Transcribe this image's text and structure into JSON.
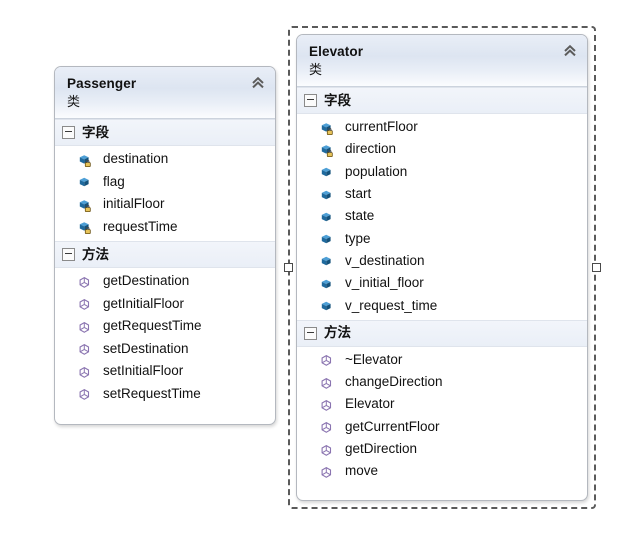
{
  "diagram": {
    "background_color": "#ffffff",
    "accent_color": "#dde5f1",
    "field_icon_color": "#1f6a9e",
    "method_icon_color": "#8a74b0"
  },
  "classes": [
    {
      "name": "Passenger",
      "kind_label": "类",
      "selected": false,
      "collapse_icon": "chevron-double-up-icon",
      "compartments": [
        {
          "title": "字段",
          "expander_state": "expanded",
          "members": [
            {
              "name": "destination",
              "icon": "field-icon",
              "visibility": "private"
            },
            {
              "name": "flag",
              "icon": "field-icon",
              "visibility": "public"
            },
            {
              "name": "initialFloor",
              "icon": "field-icon",
              "visibility": "private"
            },
            {
              "name": "requestTime",
              "icon": "field-icon",
              "visibility": "private"
            }
          ]
        },
        {
          "title": "方法",
          "expander_state": "expanded",
          "members": [
            {
              "name": "getDestination",
              "icon": "method-icon",
              "visibility": "public"
            },
            {
              "name": "getInitialFloor",
              "icon": "method-icon",
              "visibility": "public"
            },
            {
              "name": "getRequestTime",
              "icon": "method-icon",
              "visibility": "public"
            },
            {
              "name": "setDestination",
              "icon": "method-icon",
              "visibility": "public"
            },
            {
              "name": "setInitialFloor",
              "icon": "method-icon",
              "visibility": "public"
            },
            {
              "name": "setRequestTime",
              "icon": "method-icon",
              "visibility": "public"
            }
          ]
        }
      ]
    },
    {
      "name": "Elevator",
      "kind_label": "类",
      "selected": true,
      "collapse_icon": "chevron-double-up-icon",
      "compartments": [
        {
          "title": "字段",
          "expander_state": "expanded",
          "members": [
            {
              "name": "currentFloor",
              "icon": "field-icon",
              "visibility": "private"
            },
            {
              "name": "direction",
              "icon": "field-icon",
              "visibility": "private"
            },
            {
              "name": "population",
              "icon": "field-icon",
              "visibility": "public"
            },
            {
              "name": "start",
              "icon": "field-icon",
              "visibility": "public"
            },
            {
              "name": "state",
              "icon": "field-icon",
              "visibility": "public"
            },
            {
              "name": "type",
              "icon": "field-icon",
              "visibility": "public"
            },
            {
              "name": "v_destination",
              "icon": "field-icon",
              "visibility": "public"
            },
            {
              "name": "v_initial_floor",
              "icon": "field-icon",
              "visibility": "public"
            },
            {
              "name": "v_request_time",
              "icon": "field-icon",
              "visibility": "public"
            }
          ]
        },
        {
          "title": "方法",
          "expander_state": "expanded",
          "members": [
            {
              "name": "~Elevator",
              "icon": "method-icon",
              "visibility": "public"
            },
            {
              "name": "changeDirection",
              "icon": "method-icon",
              "visibility": "public"
            },
            {
              "name": "Elevator",
              "icon": "method-icon",
              "visibility": "public"
            },
            {
              "name": "getCurrentFloor",
              "icon": "method-icon",
              "visibility": "public"
            },
            {
              "name": "getDirection",
              "icon": "method-icon",
              "visibility": "public"
            },
            {
              "name": "move",
              "icon": "method-icon",
              "visibility": "public"
            }
          ]
        }
      ]
    }
  ]
}
